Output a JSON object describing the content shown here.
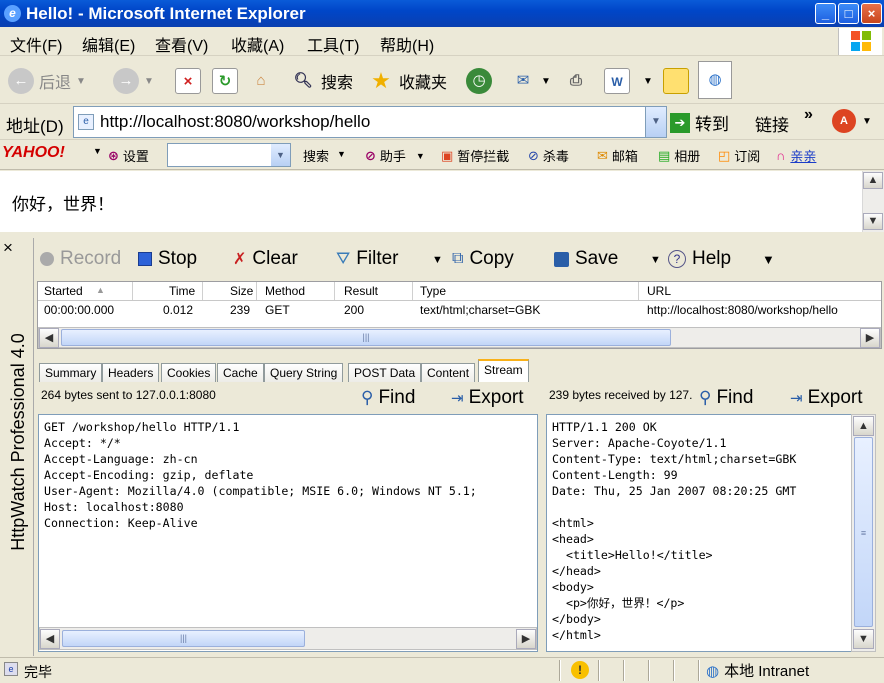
{
  "window": {
    "title": "Hello! - Microsoft Internet Explorer"
  },
  "menu": [
    "文件(F)",
    "编辑(E)",
    "查看(V)",
    "收藏(A)",
    "工具(T)",
    "帮助(H)"
  ],
  "toolbar": {
    "back": "后退",
    "search": "搜索",
    "favorites": "收藏夹"
  },
  "address": {
    "label": "地址(D)",
    "url": "http://localhost:8080/workshop/hello",
    "go": "转到",
    "links": "链接"
  },
  "yahoo": {
    "logo": "YAHOO!",
    "settings": "设置",
    "search": "搜索",
    "assistant": "助手",
    "pause_block": "暂停拦截",
    "antivirus": "杀毒",
    "mail": "邮箱",
    "album": "相册",
    "subscribe": "订阅",
    "qinqin": "亲亲"
  },
  "page": {
    "body_text": "你好，世界！"
  },
  "httpwatch": {
    "side_title": "HttpWatch Professional 4.0",
    "close": "×",
    "buttons": {
      "record": "Record",
      "stop": "Stop",
      "clear": "Clear",
      "filter": "Filter",
      "copy": "Copy",
      "save": "Save",
      "help": "Help"
    },
    "columns": [
      "Started",
      "Time",
      "Size",
      "Method",
      "Result",
      "Type",
      "URL"
    ],
    "rows": [
      {
        "started": "00:00:00.000",
        "time": "0.012",
        "size": "239",
        "method": "GET",
        "result": "200",
        "type": "text/html;charset=GBK",
        "url": "http://localhost:8080/workshop/hello"
      }
    ],
    "tabs": [
      "Summary",
      "Headers",
      "Cookies",
      "Cache",
      "Query String",
      "POST Data",
      "Content",
      "Stream"
    ],
    "active_tab": "Stream",
    "sent_caption": "264 bytes sent to 127.0.0.1:8080",
    "received_caption": "239 bytes received by 127.",
    "find": "Find",
    "export": "Export",
    "request": "GET /workshop/hello HTTP/1.1\nAccept: */*\nAccept-Language: zh-cn\nAccept-Encoding: gzip, deflate\nUser-Agent: Mozilla/4.0 (compatible; MSIE 6.0; Windows NT 5.1;\nHost: localhost:8080\nConnection: Keep-Alive",
    "response": "HTTP/1.1 200 OK\nServer: Apache-Coyote/1.1\nContent-Type: text/html;charset=GBK\nContent-Length: 99\nDate: Thu, 25 Jan 2007 08:20:25 GMT\n\n<html>\n<head>\n  <title>Hello!</title>\n</head>\n<body>\n  <p>你好，世界！</p>\n</body>\n</html>",
    "grid_scroll_mark": "|||",
    "pane_scroll_mark": "|||"
  },
  "status": {
    "text": "完毕",
    "zone": "本地 Intranet"
  },
  "colors": {
    "titlebar": "#0046c8",
    "chrome": "#ece9d8",
    "accent_tab": "#f9b119"
  }
}
